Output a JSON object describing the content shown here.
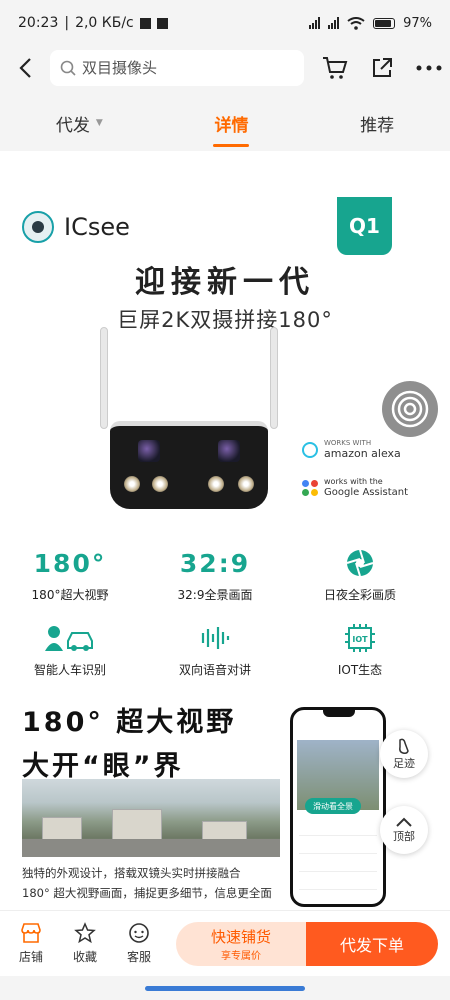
{
  "status_bar": {
    "time": "20:23",
    "network_speed": "2,0 КБ/с",
    "battery": "97",
    "battery_unit": "%"
  },
  "search": {
    "placeholder": "双目摄像头"
  },
  "tabs": [
    {
      "label": "代发",
      "active": false
    },
    {
      "label": "详情",
      "active": true
    },
    {
      "label": "推荐",
      "active": false
    }
  ],
  "product": {
    "brand": "ICsee",
    "model_badge": "Q1",
    "headline": "迎接新一代",
    "subheadline": "巨屏2K双摄拼接180°",
    "assistants": {
      "alexa_small": "WORKS WITH",
      "alexa_name": "amazon alexa",
      "google_small": "works with the",
      "google_name": "Google Assistant"
    },
    "features": [
      {
        "big": "180°",
        "label": "180°超大视野"
      },
      {
        "big": "32:9",
        "label": "32:9全景画面"
      },
      {
        "icon": "aperture-icon",
        "label": "日夜全彩画质"
      },
      {
        "icon": "person-car-icon",
        "label": "智能人车识别"
      },
      {
        "icon": "voice-wave-icon",
        "label": "双向语音对讲"
      },
      {
        "icon": "iot-chip-icon",
        "label": "IOT生态"
      }
    ],
    "promo_line1": "180° 超大视野",
    "promo_line2": "大开“眼”界",
    "desc_line1": "独特的外观设计，搭载双镜头实时拼接融合",
    "desc_line2": "180° 超大视野画面，捕捉更多细节，信息更全面",
    "phone_button": "滑动看全景"
  },
  "side_buttons": {
    "footprint": "足迹",
    "top": "顶部"
  },
  "bottom_bar": {
    "shop": "店铺",
    "favorite": "收藏",
    "service": "客服",
    "quick_stock": "快速铺货",
    "quick_stock_sub": "享专属价",
    "dropship_order": "代发下单"
  },
  "colors": {
    "accent": "#ff6a00",
    "teal": "#17a58f",
    "cta": "#ff5a1f"
  }
}
